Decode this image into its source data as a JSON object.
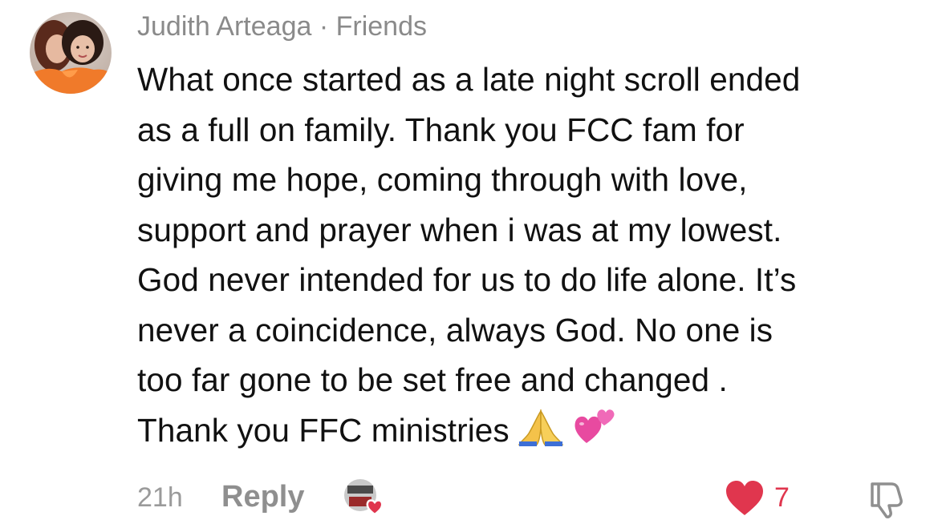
{
  "comment": {
    "author": "Judith Arteaga",
    "separator": "·",
    "relationship": "Friends",
    "body_lines": [
      "What once started as a late night scroll ended",
      "as a full on family. Thank you FCC fam for",
      "giving me hope, coming through with love,",
      "support and prayer when i was at my lowest.",
      "God never intended for us to do life alone. It’s",
      "never a coincidence, always God. No one is",
      "too far gone to be set free and changed .",
      "Thank you FFC ministries"
    ],
    "trailing_emojis": [
      "folded-hands-icon",
      "two-hearts-icon"
    ],
    "timestamp": "21h",
    "reply_label": "Reply",
    "like_count": "7"
  },
  "colors": {
    "meta_gray": "#8a8a8a",
    "text": "#111111",
    "like_red": "#e0364e",
    "icon_gray": "#8f8f8f"
  }
}
